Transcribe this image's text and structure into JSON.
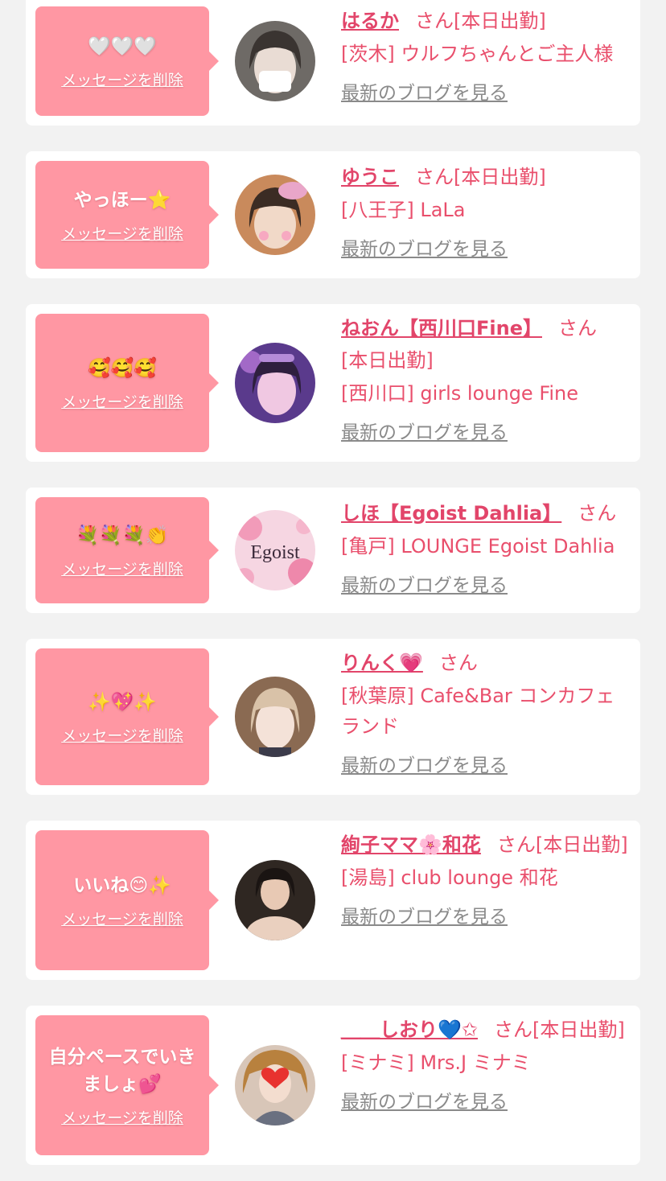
{
  "delete_label": "メッセージを削除",
  "blog_label": "最新のブログを見る",
  "honorific": "さん",
  "colors": {
    "bubble": "#ff97a3",
    "accent": "#e94f6c",
    "card": "#ffffff",
    "background": "#f2f2f2",
    "link_gray": "#8a8a8a"
  },
  "messages": [
    {
      "message": "🤍🤍🤍",
      "name": "はるか",
      "status": "[本日出勤]",
      "shop": "[茨木] ウルフちゃんとご主人様",
      "avatar": "portrait-dark-hair"
    },
    {
      "message": "やっほー⭐",
      "name": "ゆうこ",
      "status": "[本日出勤]",
      "shop": "[八王子] LaLa",
      "avatar": "portrait-ribbon"
    },
    {
      "message": "🥰🥰🥰",
      "name": "ねおん【西川口Fine】",
      "status": "[本日出勤]",
      "shop": "[西川口] girls lounge Fine",
      "avatar": "portrait-purple-light"
    },
    {
      "message": "💐💐💐👏",
      "name": "しほ【Egoist Dahlia】",
      "status": "",
      "shop": "[亀戸] LOUNGE Egoist Dahlia",
      "avatar": "egoist-logo",
      "logo_text": "Egoist"
    },
    {
      "message": "✨💖✨",
      "name": "りんく💗",
      "status": "",
      "shop": "[秋葉原] Cafe&Bar コンカフェランド",
      "avatar": "portrait-blonde"
    },
    {
      "message": "いいね😊✨",
      "name": "絢子ママ🌸和花",
      "status": "[本日出勤]",
      "shop": "[湯島] club lounge 和花",
      "avatar": "portrait-dark-room"
    },
    {
      "message": "自分ペースでいきましょ💕",
      "name": "＿＿しおり💙✩",
      "status": "[本日出勤]",
      "shop": "[ミナミ] Mrs.J ミナミ",
      "avatar": "portrait-heart"
    }
  ]
}
